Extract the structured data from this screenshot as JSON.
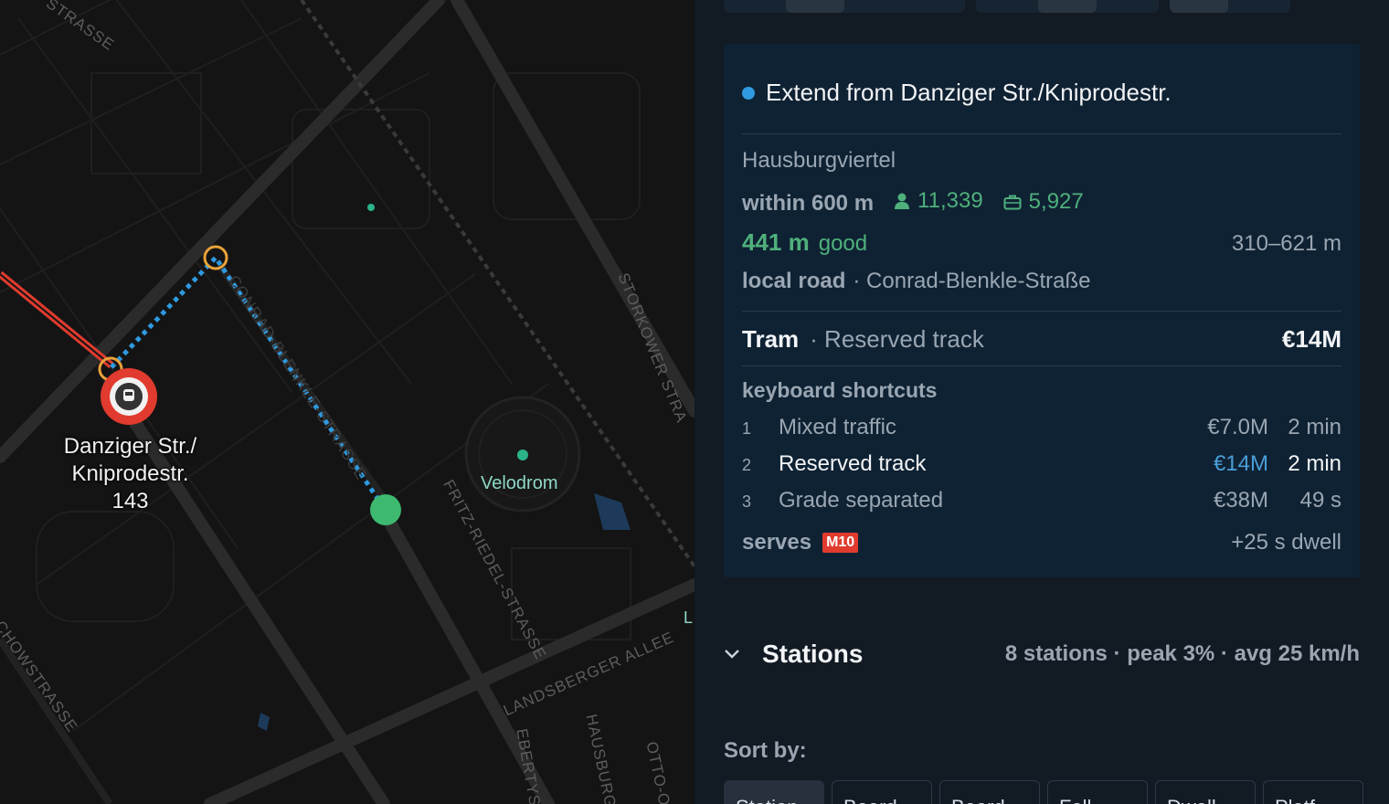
{
  "map": {
    "station_label_line1": "Danziger Str./",
    "station_label_line2": "Kniprodestr.",
    "station_label_line3": "143",
    "poi_label": "Velodrom",
    "edge_label": "L",
    "streets": {
      "top": "STRASSE",
      "storkower": "STORKOWER STRA",
      "fritz": "FRITZ-RIEDEL-STRASSE",
      "landsberger": "LANDSBERGER ALLEE",
      "ebertyst": "EBERTYST",
      "hausburg": "HAUSBURG",
      "otto": "OTTO-O",
      "chowstrasse": "CHOWSTRASSE",
      "conrad": "CONRAD-BLENKLE-STRASSE"
    }
  },
  "card": {
    "title": "Extend from Danziger Str./Kniprodestr.",
    "area": "Hausburgviertel",
    "within": "within 600 m",
    "population": "11,339",
    "jobs": "5,927",
    "distance": "441 m",
    "distance_rating": "good",
    "distance_range": "310–621 m",
    "road_type": "local road",
    "road_name": "· Conrad-Blenkle-Straße",
    "mode": "Tram",
    "mode_option": "· Reserved track",
    "mode_cost": "€14M",
    "shortcuts_heading": "keyboard shortcuts",
    "shortcuts": [
      {
        "key": "1",
        "label": "Mixed traffic",
        "cost": "€7.0M",
        "time": "2 min"
      },
      {
        "key": "2",
        "label": "Reserved track",
        "cost": "€14M",
        "time": "2 min"
      },
      {
        "key": "3",
        "label": "Grade separated",
        "cost": "€38M",
        "time": "49 s"
      }
    ],
    "serves_label": "serves",
    "serves_line": "M10",
    "dwell": "+25 s dwell"
  },
  "stations": {
    "title": "Stations",
    "summary": "8 stations · peak 3% · avg 25 km/h"
  },
  "sort": {
    "label": "Sort by:",
    "buttons": [
      "Station",
      "Board",
      "Board",
      "Fall",
      "Dwell",
      "Platf"
    ]
  },
  "colors": {
    "accent_blue": "#2f9ae0",
    "green": "#4fb07c",
    "red_line": "#e03b2e",
    "orange_ring": "#e8a23a",
    "station_green": "#3dba6f"
  }
}
